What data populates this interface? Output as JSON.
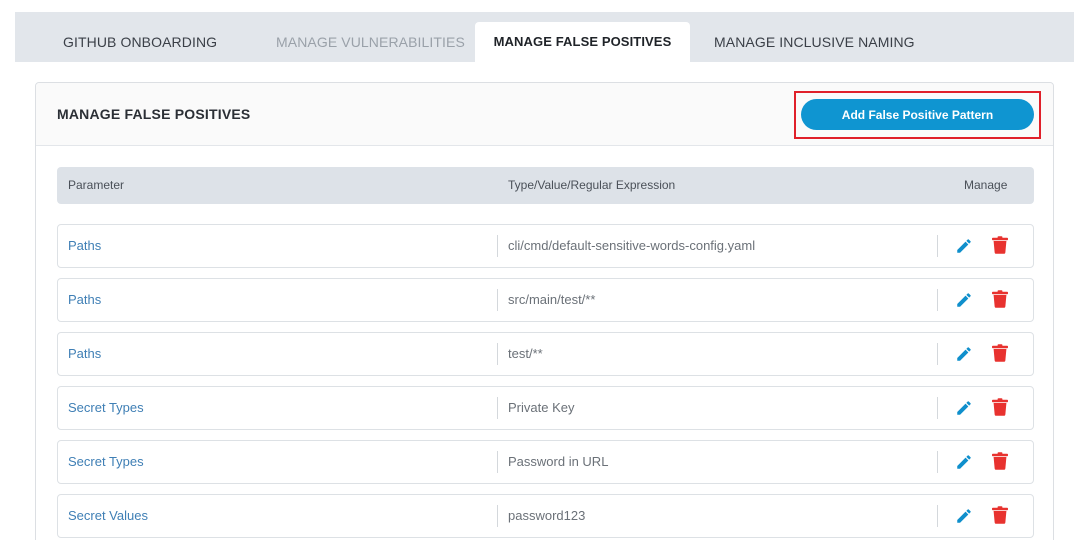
{
  "tabs": [
    {
      "label": "GITHUB ONBOARDING"
    },
    {
      "label": "MANAGE VULNERABILITIES"
    },
    {
      "label": "MANAGE FALSE POSITIVES"
    },
    {
      "label": "MANAGE INCLUSIVE NAMING"
    }
  ],
  "active_tab": "MANAGE FALSE POSITIVES",
  "panel": {
    "title": "MANAGE FALSE POSITIVES",
    "add_button_label": "Add False Positive Pattern"
  },
  "table": {
    "headers": {
      "parameter": "Parameter",
      "type_value": "Type/Value/Regular Expression",
      "manage": "Manage"
    },
    "rows": [
      {
        "parameter": "Paths",
        "value": "cli/cmd/default-sensitive-words-config.yaml"
      },
      {
        "parameter": "Paths",
        "value": "src/main/test/**"
      },
      {
        "parameter": "Paths",
        "value": "test/**"
      },
      {
        "parameter": "Secret Types",
        "value": "Private Key"
      },
      {
        "parameter": "Secret Types",
        "value": "Password in URL"
      },
      {
        "parameter": "Secret Values",
        "value": "password123"
      }
    ]
  },
  "icons": {
    "edit": "pencil-icon",
    "delete": "trash-icon"
  },
  "colors": {
    "accent": "#0f95d1",
    "highlight": "#e0202a",
    "delete": "#e8322f",
    "param_text": "#3f7fb5"
  }
}
